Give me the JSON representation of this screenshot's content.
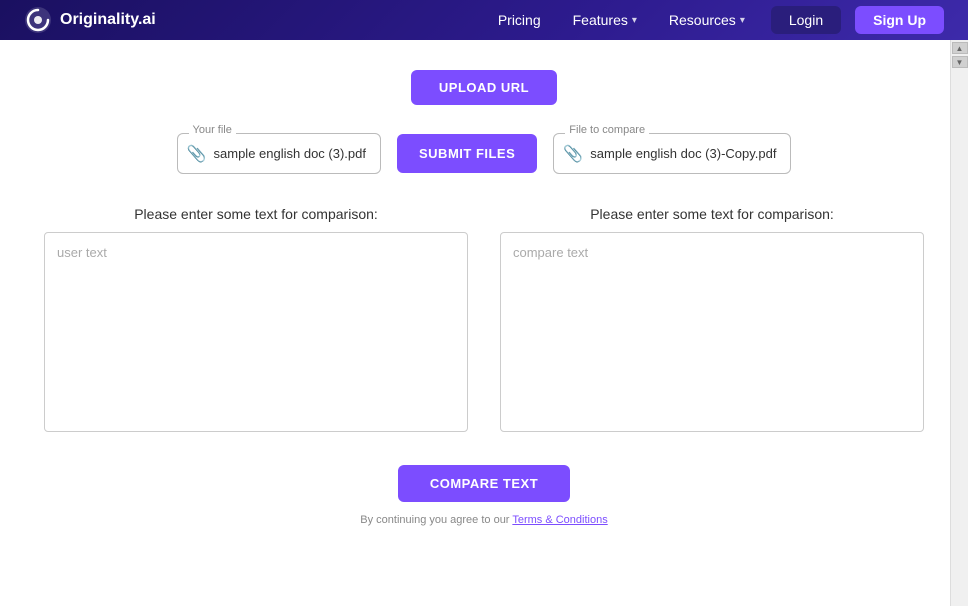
{
  "nav": {
    "logo_text": "Originality.ai",
    "links": [
      {
        "label": "Pricing",
        "has_chevron": false
      },
      {
        "label": "Features",
        "has_chevron": true
      },
      {
        "label": "Resources",
        "has_chevron": true
      }
    ],
    "login_label": "Login",
    "signup_label": "Sign Up"
  },
  "main": {
    "upload_url_label": "UPLOAD URL",
    "your_file_label": "Your file",
    "your_file_name": "sample english doc (3).pdf",
    "file_to_compare_label": "File to compare",
    "file_to_compare_name": "sample english doc (3)-Copy.pdf",
    "submit_files_label": "SUBMIT FILES",
    "text_comparison_label_left": "Please enter some text for comparison:",
    "text_comparison_label_right": "Please enter some text for comparison:",
    "user_text_placeholder": "user text",
    "compare_text_placeholder": "compare text",
    "compare_btn_label": "COMPARE TEXT",
    "footer_note": "By continuing you agree to our ",
    "footer_link": "Terms & Conditions"
  },
  "scrollbar": {
    "up_arrow": "▲",
    "down_arrow": "▼"
  }
}
